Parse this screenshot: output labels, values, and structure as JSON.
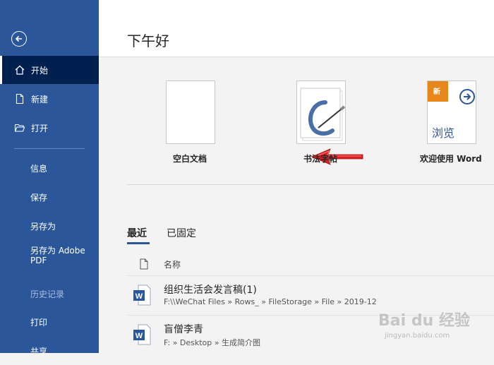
{
  "sidebar": {
    "back_icon": "back-arrow-icon",
    "items": [
      {
        "label": "开始",
        "icon": "home-icon"
      },
      {
        "label": "新建",
        "icon": "new-document-icon"
      },
      {
        "label": "打开",
        "icon": "open-folder-icon"
      },
      {
        "label": "信息"
      },
      {
        "label": "保存"
      },
      {
        "label": "另存为"
      },
      {
        "label": "另存为 Adobe PDF"
      },
      {
        "label": "历史记录"
      },
      {
        "label": "打印"
      },
      {
        "label": "共享"
      }
    ]
  },
  "main": {
    "greeting": "下午好",
    "templates": [
      {
        "label": "空白文档"
      },
      {
        "label": "书法字帖"
      },
      {
        "label": "欢迎使用 Word",
        "badge": "新",
        "thumb_text": "浏览"
      }
    ],
    "tabs": [
      {
        "label": "最近",
        "active": true
      },
      {
        "label": "已固定",
        "active": false
      }
    ],
    "column_header": "名称",
    "documents": [
      {
        "title": "组织生活会发言稿(1)",
        "path": "F:\\\\WeChat Files » Rows_ » FileStorage » File » 2019-12"
      },
      {
        "title": "盲僧李青",
        "path": "F: » Desktop » 生成简介图"
      }
    ]
  },
  "watermark": {
    "text": "Bai du 经验",
    "sub": "jingyan.baidu.com"
  },
  "colors": {
    "sidebar": "#2b579a",
    "selected": "#002050",
    "accent": "#2b579a",
    "badge": "#e8881a",
    "arrow": "#e02020"
  }
}
